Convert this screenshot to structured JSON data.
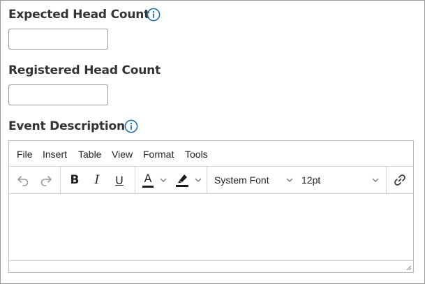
{
  "fields": {
    "expected_head_count": {
      "label": "Expected Head Count",
      "value": ""
    },
    "registered_head_count": {
      "label": "Registered Head Count",
      "value": ""
    },
    "event_description": {
      "label": "Event Description"
    }
  },
  "editor": {
    "menu": [
      "File",
      "Insert",
      "Table",
      "View",
      "Format",
      "Tools"
    ],
    "toolbar": {
      "undo_icon": "undo-icon",
      "redo_icon": "redo-icon",
      "bold": "B",
      "italic": "I",
      "underline": "U",
      "text_color_letter": "A",
      "font_family": "System Font",
      "font_size": "12pt",
      "link_icon": "link-icon"
    },
    "content": ""
  },
  "colors": {
    "info_blue": "#1f6fb2",
    "text": "#2b2b2b",
    "border": "#9a9a9a",
    "icon_gray": "#999999"
  }
}
